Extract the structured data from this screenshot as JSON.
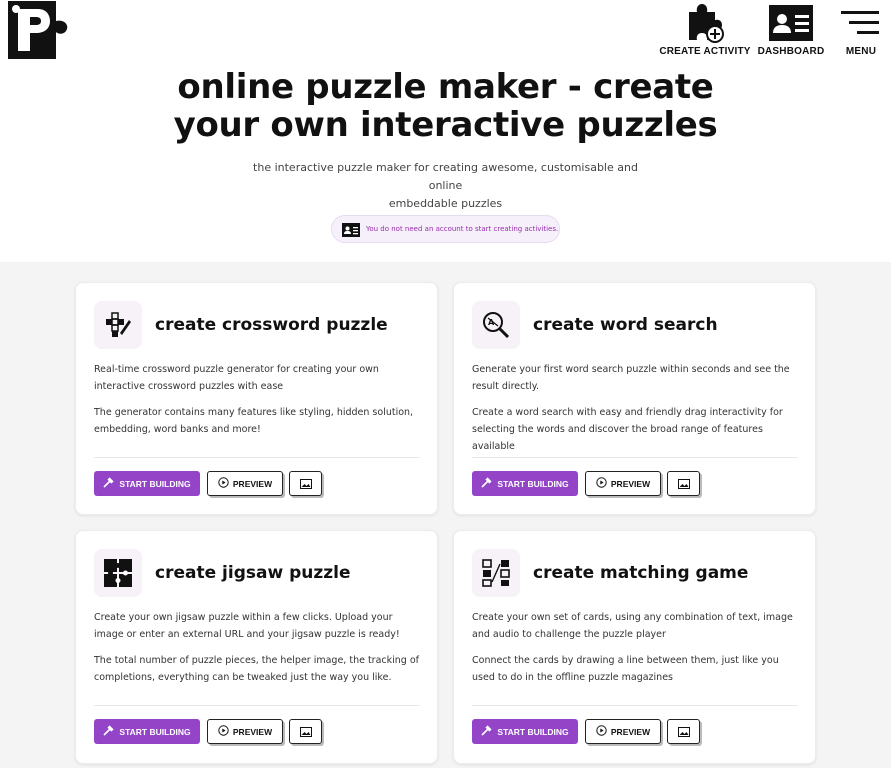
{
  "nav": {
    "create_label": "CREATE ACTIVITY",
    "dashboard_label": "DASHBOARD",
    "menu_label": "MENU"
  },
  "hero": {
    "title_line1": "online puzzle maker - create",
    "title_line2": "your own interactive puzzles",
    "subtitle_line1": "the interactive puzzle maker for creating awesome, customisable and online",
    "subtitle_line2": "embeddable puzzles",
    "notice": "You do not need an account to start creating activities."
  },
  "colors": {
    "accent": "#9444c7",
    "notice_text": "#9a2db0"
  },
  "cards": [
    {
      "icon": "crossword-icon",
      "title": "create crossword puzzle",
      "p1": "Real-time crossword puzzle generator for creating your own interactive crossword puzzles with ease",
      "p2": "The generator contains many features like styling, hidden solution, embedding, word banks and more!",
      "start_label": "START BUILDING",
      "preview_label": "PREVIEW"
    },
    {
      "icon": "word-search-icon",
      "title": "create word search",
      "p1": "Generate your first word search puzzle within seconds and see the result directly.",
      "p2": "Create a word search with easy and friendly drag interactivity for selecting the words and discover the broad range of features available",
      "start_label": "START BUILDING",
      "preview_label": "PREVIEW"
    },
    {
      "icon": "jigsaw-icon",
      "title": "create jigsaw puzzle",
      "p1": "Create your own jigsaw puzzle within a few clicks. Upload your image or enter an external URL and your jigsaw puzzle is ready!",
      "p2": "The total number of puzzle pieces, the helper image, the tracking of completions, everything can be tweaked just the way you like.",
      "start_label": "START BUILDING",
      "preview_label": "PREVIEW"
    },
    {
      "icon": "matching-game-icon",
      "title": "create matching game",
      "p1": "Create your own set of cards, using any combination of text, image and audio to challenge the puzzle player",
      "p2": "Connect the cards by drawing a line between them, just like you used to do in the offline puzzle magazines",
      "start_label": "START BUILDING",
      "preview_label": "PREVIEW"
    }
  ]
}
